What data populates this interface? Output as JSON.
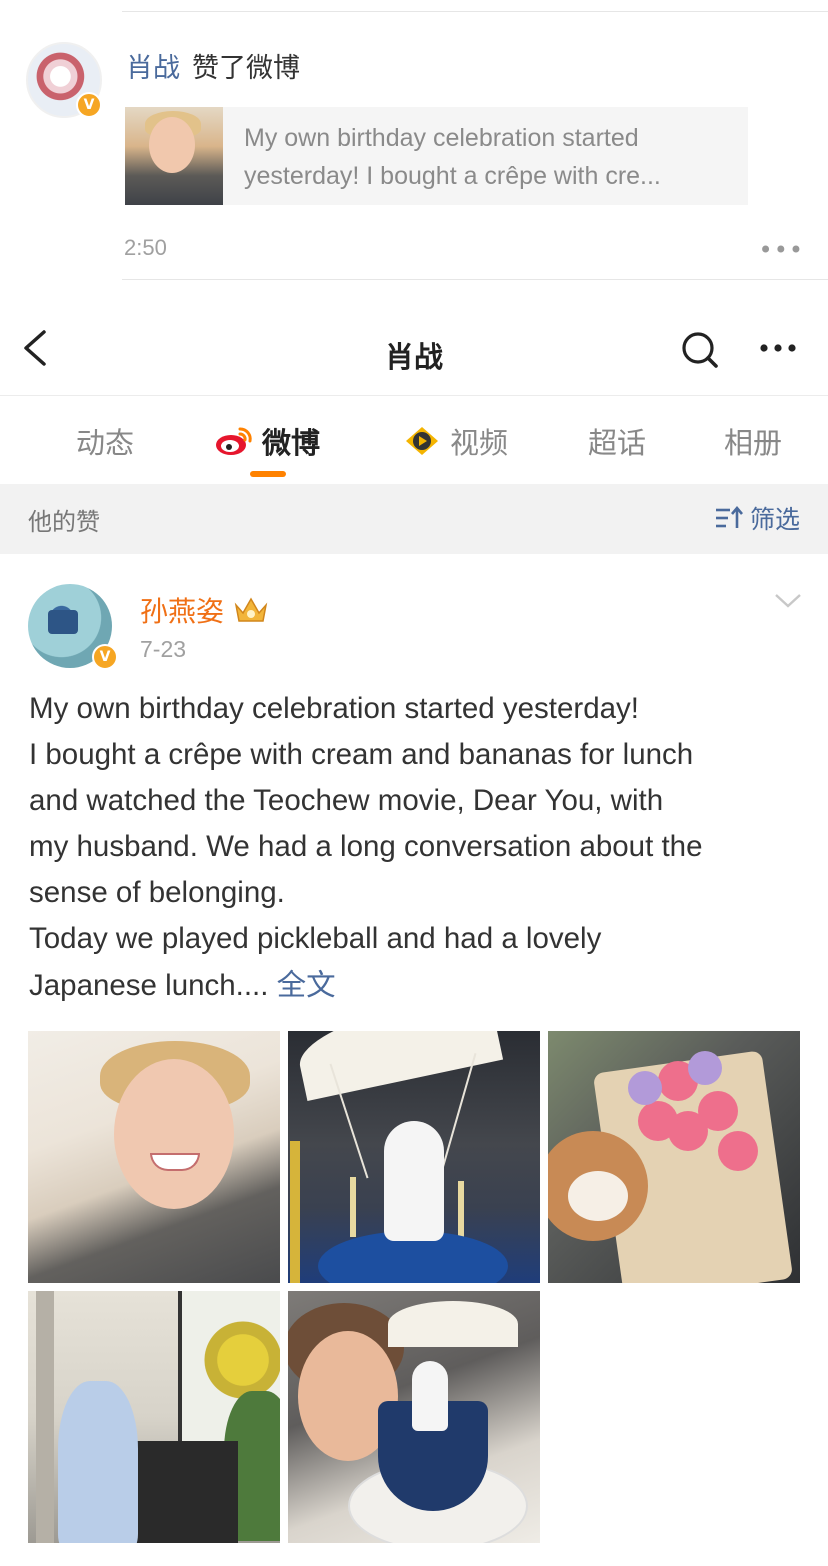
{
  "notification": {
    "user_name": "肖战",
    "action": "赞了微博",
    "verified_badge": "V",
    "quote_text": "My own birthday celebration started yesterday!  I bought a crêpe with cre...",
    "time": "2:50",
    "more_glyph": "•••"
  },
  "navbar": {
    "title": "肖战"
  },
  "tabs": [
    {
      "label": "动态",
      "icon": null
    },
    {
      "label": "微博",
      "icon": "weibo-logo-icon"
    },
    {
      "label": "视频",
      "icon": "video-icon"
    },
    {
      "label": "超话",
      "icon": null
    },
    {
      "label": "相册",
      "icon": null
    }
  ],
  "section": {
    "title": "他的赞",
    "filter_label": "筛选"
  },
  "post": {
    "author": "孙燕姿",
    "verified_badge": "V",
    "date": "7-23",
    "text_lines": [
      "My own birthday celebration started yesterday!",
      "I bought a crêpe with cream and bananas for lunch",
      "and watched the Teochew movie, Dear You, with",
      "my husband. We had a long conversation about the",
      "sense of belonging.",
      "Today we played pickleball and had a lovely",
      "Japanese lunch...."
    ],
    "full_text_link": "全文",
    "photos": [
      {
        "name": "selfie"
      },
      {
        "name": "astronaut-cake"
      },
      {
        "name": "dog-with-roses"
      },
      {
        "name": "piano-room"
      },
      {
        "name": "selfie-with-cake"
      }
    ]
  },
  "colors": {
    "accent_orange": "#ff8200",
    "link_blue": "#4a6a9c",
    "author_orange": "#f07016",
    "verified_gold": "#f6a623"
  }
}
